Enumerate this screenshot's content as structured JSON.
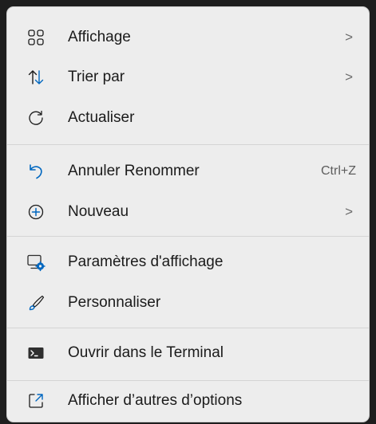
{
  "menu": {
    "items": [
      {
        "label": "Affichage",
        "icon": "grid-view-icon",
        "arrow": ">"
      },
      {
        "label": "Trier par",
        "icon": "sort-arrows-icon",
        "arrow": ">"
      },
      {
        "label": "Actualiser",
        "icon": "refresh-icon"
      },
      {
        "label": "Annuler Renommer",
        "icon": "undo-icon",
        "shortcut": "Ctrl+Z"
      },
      {
        "label": "Nouveau",
        "icon": "plus-circle-icon",
        "arrow": ">"
      },
      {
        "label": "Paramètres d'affichage",
        "icon": "display-settings-icon"
      },
      {
        "label": "Personnaliser",
        "icon": "paintbrush-icon"
      },
      {
        "label": "Ouvrir dans le Terminal",
        "icon": "terminal-icon"
      },
      {
        "label": "Afficher d’autres d’options",
        "icon": "show-more-options-icon"
      }
    ]
  },
  "colors": {
    "menu_background": "#ededed",
    "accent_blue": "#0067c0",
    "text": "#1b1b1b"
  }
}
